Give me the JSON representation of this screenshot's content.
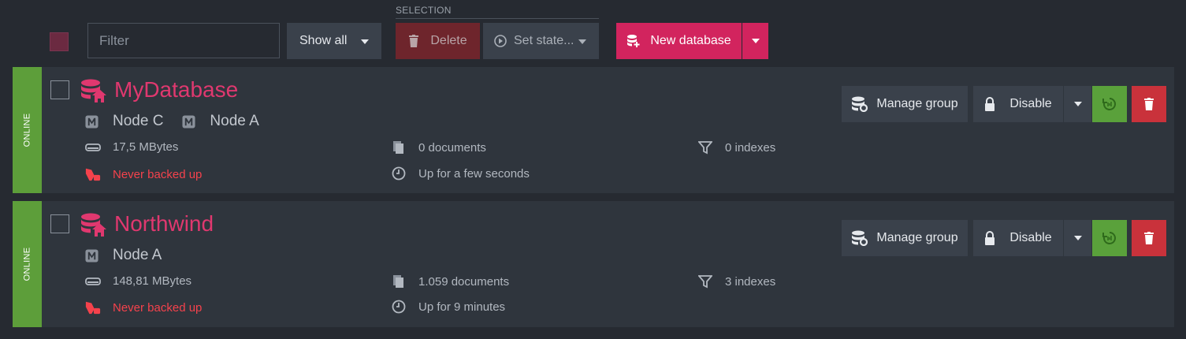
{
  "toolbar": {
    "filter_placeholder": "Filter",
    "show_all_label": "Show all",
    "selection_label": "SELECTION",
    "delete_label": "Delete",
    "set_state_label": "Set state...",
    "new_database_label": "New database"
  },
  "databases": [
    {
      "status": "ONLINE",
      "name": "MyDatabase",
      "nodes": [
        "Node C",
        "Node A"
      ],
      "size": "17,5 MBytes",
      "documents": "0 documents",
      "indexes": "0 indexes",
      "backup": "Never backed up",
      "uptime": "Up for a few seconds",
      "actions": {
        "manage_group": "Manage group",
        "disable": "Disable"
      }
    },
    {
      "status": "ONLINE",
      "name": "Northwind",
      "nodes": [
        "Node A"
      ],
      "size": "148,81 MBytes",
      "documents": "1.059 documents",
      "indexes": "3 indexes",
      "backup": "Never backed up",
      "uptime": "Up for 9 minutes",
      "actions": {
        "manage_group": "Manage group",
        "disable": "Disable"
      }
    }
  ],
  "colors": {
    "background": "#262a31",
    "panel": "#2f353d",
    "accent": "#d2245e",
    "online": "#5d9e3a",
    "warning": "#f5424c"
  },
  "icons": {
    "database": "database-home-icon",
    "node": "node-member-icon",
    "size": "disk-icon",
    "documents": "documents-icon",
    "indexes": "index-icon",
    "backup": "backup-warning-icon",
    "uptime": "clock-icon"
  }
}
